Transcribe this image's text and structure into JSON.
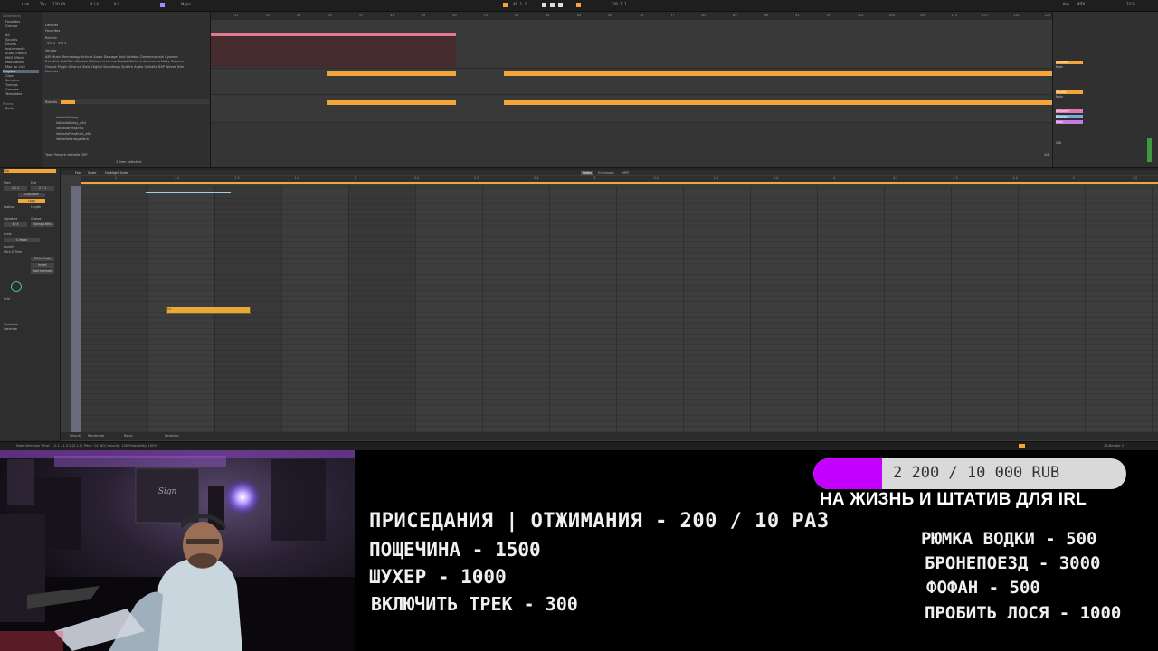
{
  "daw": {
    "topbar": {
      "link": "Link",
      "tap": "Tap",
      "tempo": "120.00",
      "sig": "4 / 4",
      "bar": "8 L",
      "scale": "Major",
      "position": "49. 1. 1",
      "loop": "129. 1. 1",
      "key": "Key",
      "midi": "MIDI",
      "cpu": "33 %"
    },
    "browser": {
      "collections": [
        "Favorites",
        "Orange"
      ],
      "library": [
        "All",
        "Sounds",
        "Drums",
        "Instruments",
        "Audio Effects",
        "MIDI Effects",
        "Modulators",
        "Max for Live",
        "Plug-Ins",
        "Clips",
        "Samples",
        "Tunings",
        "Grooves",
        "Templates"
      ],
      "places": [
        "Places",
        "Packs"
      ],
      "middle": [
        "Devices",
        "Favorites",
        "Reverb",
        "VST2",
        "VST3",
        "Vendor"
      ],
      "vendors": "AIR Music Technology  Arturia  Audio Damage  Avid  Ableton  Clearmountain  Cytomic  Eventide  FabFilter  iZotope  Kilohearts  LennarDigital  Native Instruments  Nicky Romero  Output  Plugin Alliance  Slate Digital  Soundtoys  Spitfire Audio  Valhalla DSP  Waves  Xfer Records",
      "results_label": "Results",
      "results": [
        "ValhallaDelay",
        "ValhallaDelay_x64",
        "ValhallaFreqEcho",
        "ValhallaFreqEcho_x64",
        "ValhallaVintageVerb"
      ],
      "tags": "Tags: Reverb  Valhalla DSP",
      "count": "1 item selected"
    },
    "arrangement": {
      "ruler": [
        "21",
        "25",
        "29",
        "33",
        "37",
        "41",
        "45",
        "49",
        "53",
        "57",
        "61",
        "65",
        "69",
        "73",
        "77",
        "81",
        "85",
        "89",
        "93",
        "97",
        "101",
        "105",
        "109",
        "113",
        "117",
        "121",
        "125"
      ]
    },
    "mixer": {
      "tracks": [
        {
          "name": "1 Audio",
          "label": "Main",
          "color": "#e07a8e"
        },
        {
          "name": "2 Drums",
          "label": "Main",
          "color": "#f4a53a"
        },
        {
          "name": "3 Lead",
          "label": "Main",
          "color": "#f4a53a"
        },
        {
          "name": "A Reverb",
          "label": "A",
          "color": "#e07ab0"
        },
        {
          "name": "B Delay",
          "label": "B",
          "color": "#7aa6e0"
        },
        {
          "name": "Main",
          "label": "1/2",
          "color": "#c87ae0"
        }
      ],
      "master_value": "200",
      "counter": "1/4"
    },
    "clipview": {
      "clip_label": "Clip",
      "start_label": "Start",
      "start": "1  1  1",
      "end_label": "End",
      "end": "2  1  1",
      "position_label": "Position",
      "length_label": "Length",
      "signature_label": "Signature",
      "groove_label": "Groove",
      "signature": "4 / 4",
      "groove": "Swing 16ths",
      "scale_label": "Scale",
      "scale": "C  Major",
      "buttons": [
        "Duplicate",
        "Set",
        "Loop",
        "Fit to Scale",
        "Invert",
        "Add Intervals"
      ],
      "sections": [
        "Launch",
        "Pitch & Time",
        "Transform",
        "Generate"
      ],
      "grid_label": "Grid"
    },
    "editor": {
      "tabs": [
        "Fold",
        "Scale",
        "Highlight Scale"
      ],
      "view_tabs": [
        "Notes",
        "Envelopes",
        "MPE"
      ],
      "ruler": [
        "1",
        "1.2",
        "1.3",
        "1.4",
        "2",
        "2.2",
        "2.3",
        "2.4",
        "3",
        "3.2",
        "3.3",
        "3.4",
        "4",
        "4.2",
        "4.3",
        "4.4",
        "5",
        "5.2"
      ],
      "note_label": "C4",
      "bottom": [
        "Velocity",
        "Randomize",
        "Ramp",
        "Deviation"
      ]
    },
    "status": {
      "left": "Note Selection  Time: 1.2.1 - 1.3.1 (0.1.0)  Pitch: C4 (60)  Velocity: 100  Probability: 100%",
      "right": "2B-Bender 2"
    }
  },
  "overlay": {
    "goal_current": "2 200 / 10 000 RUB",
    "goal_progress": 0.22,
    "goal_caption": "НА ЖИЗНЬ И ШТАТИВ ДЛЯ IRL",
    "left_menu": [
      "ПРИСЕДАНИЯ | ОТЖИМАНИЯ - 200 / 10 РАЗ",
      "ПОЩЕЧИНА - 1500",
      "ШУХЕР - 1000",
      "ВКЛЮЧИТЬ ТРЕК - 300"
    ],
    "right_menu": [
      "РЮМКА ВОДКИ - 500",
      "БРОНЕПОЕЗД - 3000",
      "ФОФАН - 500",
      "ПРОБИТЬ ЛОСЯ - 1000"
    ]
  }
}
